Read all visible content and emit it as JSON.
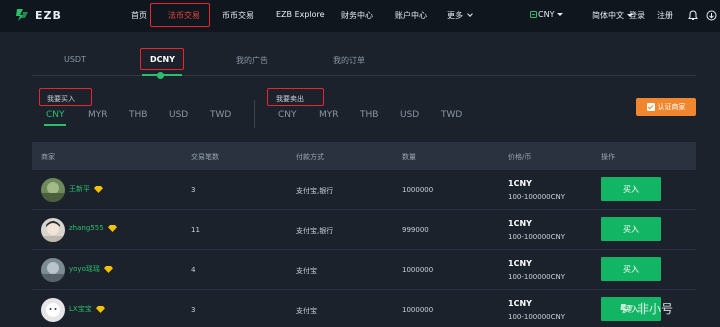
{
  "brand": {
    "logo_text": "EZB"
  },
  "nav": {
    "items": [
      "首页",
      "法币交易",
      "币币交易",
      "EZB Explore",
      "财务中心",
      "账户中心",
      "更多"
    ],
    "currency": "CNY",
    "language": "简体中文",
    "login": "登录",
    "register": "注册"
  },
  "tabs": [
    "USDT",
    "DCNY",
    "我的广告",
    "我的订单"
  ],
  "buy_section": {
    "label": "我要买入",
    "currencies": [
      "CNY",
      "MYR",
      "THB",
      "USD",
      "TWD"
    ]
  },
  "sell_section": {
    "label": "我要卖出",
    "currencies": [
      "CNY",
      "MYR",
      "THB",
      "USD",
      "TWD"
    ]
  },
  "cert_button": "认证商家",
  "table": {
    "headers": [
      "商家",
      "交易笔数",
      "付款方式",
      "数量",
      "价格/币",
      "操作"
    ],
    "rows": [
      {
        "merchant": "王新平",
        "trades": "3",
        "payment": "支付宝,银行",
        "quantity": "1000000",
        "price": "1CNY",
        "range": "100-100000CNY",
        "action": "买入"
      },
      {
        "merchant": "zhang555",
        "trades": "11",
        "payment": "支付宝,银行",
        "quantity": "999000",
        "price": "1CNY",
        "range": "100-100000CNY",
        "action": "买入"
      },
      {
        "merchant": "yoyo瑶瑶",
        "trades": "4",
        "payment": "支付宝",
        "quantity": "1000000",
        "price": "1CNY",
        "range": "100-100000CNY",
        "action": "买入"
      },
      {
        "merchant": "LX宝宝",
        "trades": "3",
        "payment": "支付宝",
        "quantity": "1000000",
        "price": "1CNY",
        "range": "100-100000CNY",
        "action": "买入"
      }
    ]
  },
  "watermark": "非小号",
  "colors": {
    "accent": "#2bbf6c",
    "buy_button": "#11b564",
    "cert": "#f0862d",
    "highlight_box": "#e8262c",
    "diamond": "#f2c300"
  }
}
